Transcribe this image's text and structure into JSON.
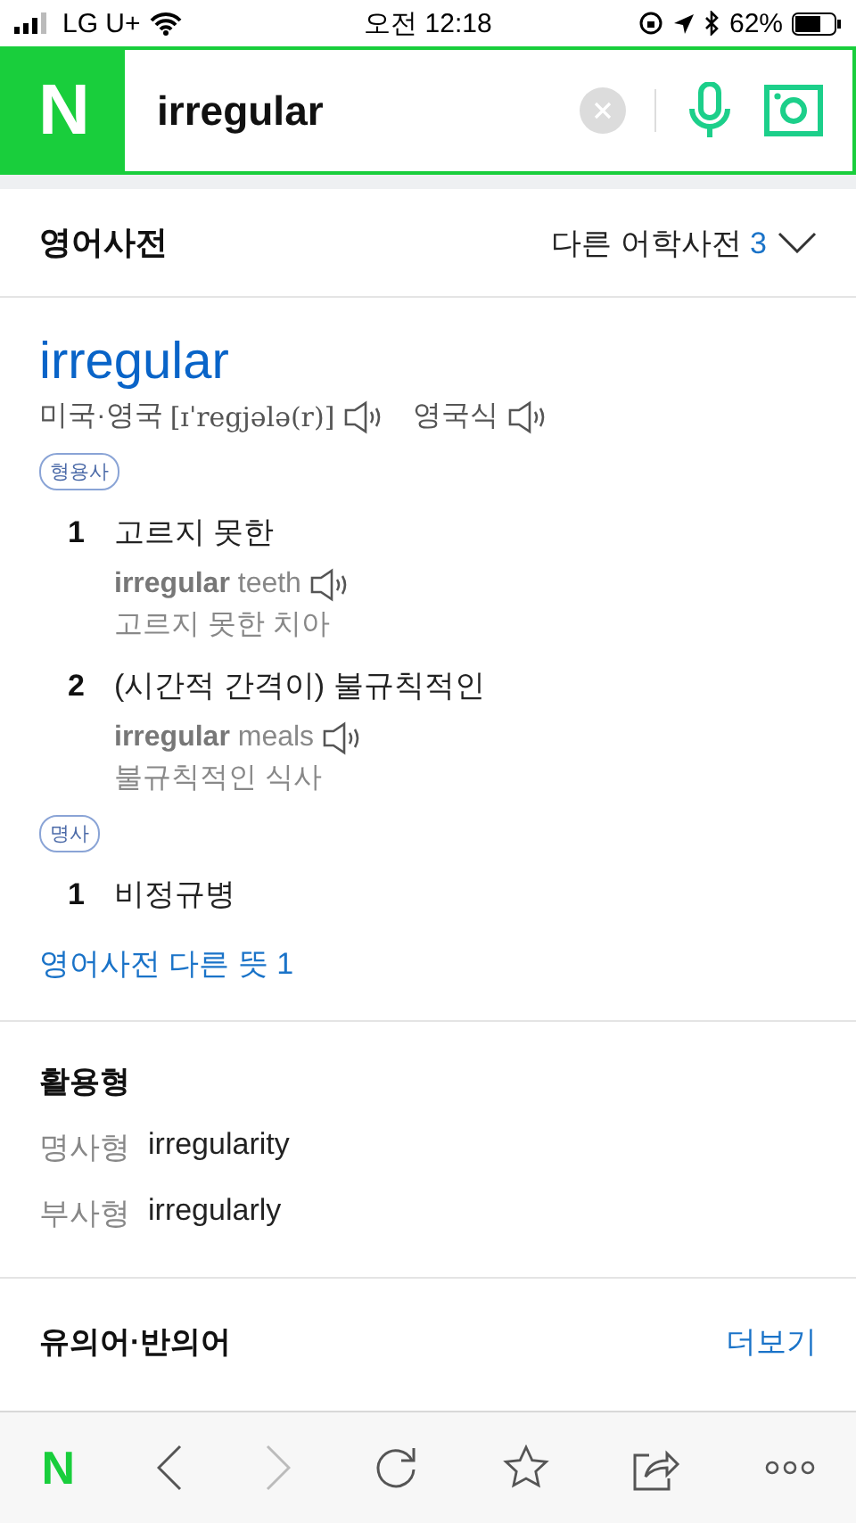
{
  "status_bar": {
    "carrier": "LG U+",
    "time": "오전 12:18",
    "battery": "62%"
  },
  "search": {
    "logo": "N",
    "value": "irregular"
  },
  "dictionary_header": {
    "title": "영어사전",
    "other_dicts": "다른 어학사전",
    "other_count": "3"
  },
  "entry": {
    "word": "irregular",
    "pron_label": "미국·영국",
    "pron": "[ɪˈregjələ(r)]",
    "uk_label": "영국식",
    "parts": [
      {
        "pos": "형용사",
        "senses": [
          {
            "num": "1",
            "meaning": "고르지 못한",
            "example": "**irregular** teeth",
            "translation": "고르지 못한 치아"
          },
          {
            "num": "2",
            "meaning": "(시간적 간격이) 불규칙적인",
            "example": "**irregular** meals",
            "translation": "불규칙적인 식사"
          }
        ]
      },
      {
        "pos": "명사",
        "senses": [
          {
            "num": "1",
            "meaning": "비정규병"
          }
        ]
      }
    ],
    "more_link": "영어사전 다른 뜻 1"
  },
  "forms": {
    "title": "활용형",
    "rows": [
      {
        "label": "명사형",
        "value": "irregularity"
      },
      {
        "label": "부사형",
        "value": "irregularly"
      }
    ]
  },
  "synonyms": {
    "title": "유의어·반의어",
    "more": "더보기"
  },
  "toolbar": {
    "logo": "N",
    "forward_disabled": true
  }
}
